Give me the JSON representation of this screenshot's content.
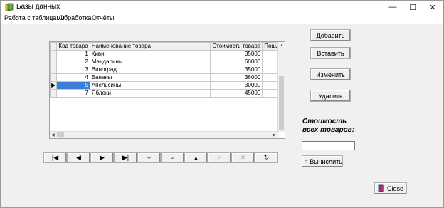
{
  "window": {
    "title": "Базы данных",
    "min": "—",
    "max": "☐",
    "close": "✕"
  },
  "menu": [
    "Работа с таблицами",
    "Обработка",
    "Отчёты"
  ],
  "grid": {
    "columns": [
      "Код товара",
      "Наименование товара",
      "Стоимость товара",
      "Пошли"
    ],
    "rows": [
      {
        "code": "1",
        "name": "Киви",
        "price": "35000"
      },
      {
        "code": "2",
        "name": "Мандарины",
        "price": "60000"
      },
      {
        "code": "3",
        "name": "Виноград",
        "price": "35000"
      },
      {
        "code": "4",
        "name": "Бананы",
        "price": "36000"
      },
      {
        "code": "5",
        "name": "Апельсины",
        "price": "30000",
        "selected": true
      },
      {
        "code": "7",
        "name": "Яблоки",
        "price": "45000"
      }
    ]
  },
  "buttons": {
    "add": "Добавить",
    "insert": "Вставить",
    "edit": "Изменить",
    "delete": "Удалить",
    "calc": "Вычислить",
    "close": "Close"
  },
  "navigator": [
    "|◀",
    "◀",
    "▶",
    "▶|",
    "+",
    "−",
    "▲",
    "✓",
    "✕",
    "↻"
  ],
  "sum": {
    "label_line1": "Стоимость",
    "label_line2": "всех товаров:",
    "value": ""
  }
}
